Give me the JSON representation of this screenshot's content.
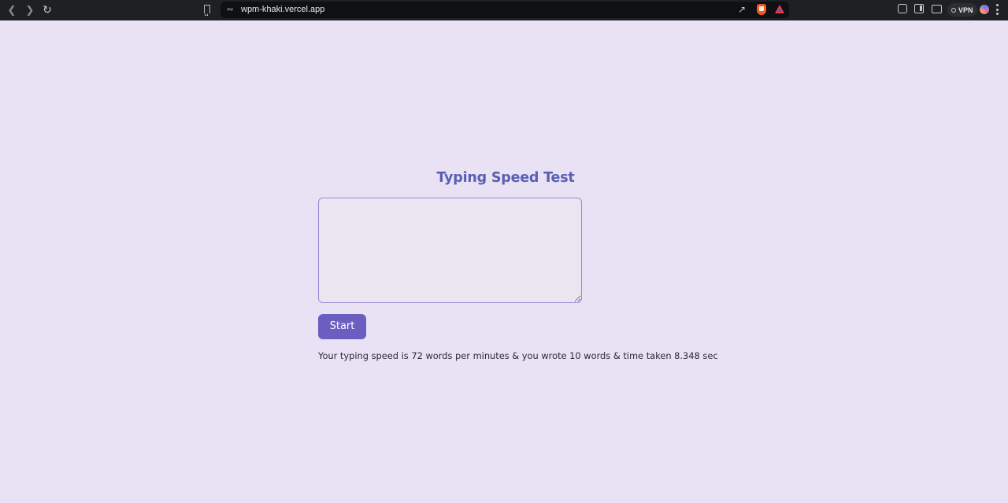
{
  "browser": {
    "url": "wpm-khaki.vercel.app",
    "vpn_label": "VPN",
    "icons": [
      "back-icon",
      "forward-icon",
      "reload-icon",
      "bookmark-icon",
      "site-settings-icon",
      "share-icon",
      "brave-shields-icon",
      "brave-rewards-icon",
      "extensions-icon",
      "sidebar-icon",
      "wallet-icon",
      "profile-avatar",
      "menu-icon"
    ]
  },
  "app": {
    "title": "Typing Speed Test",
    "input_value": "",
    "start_label": "Start",
    "result": "Your typing speed is 72 words per minutes & you wrote 10 words & time taken 8.348 sec"
  },
  "colors": {
    "background": "#e9e1f4",
    "title": "#5a5fb2",
    "button": "#6a5fc0",
    "input_border": "#9b88d7"
  }
}
